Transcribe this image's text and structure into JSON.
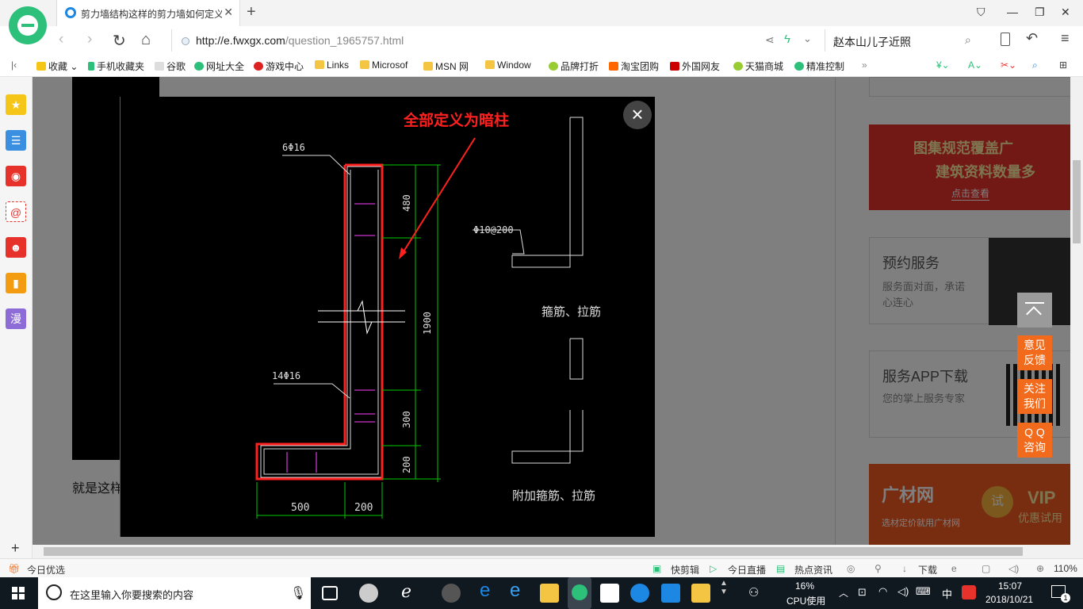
{
  "browser": {
    "tab_title": "剪力墙结构这样的剪力墙如何定义",
    "url_main": "http://e.fwxgx.com",
    "url_path": "/question_1965757.html",
    "search_query": "赵本山儿子近照"
  },
  "bookmarks": [
    "收藏",
    "手机收藏夹",
    "谷歌",
    "网址大全",
    "游戏中心",
    "Links",
    "Microsof",
    "MSN 网",
    "Window",
    "品牌打折",
    "淘宝团购",
    "外国网友",
    "天猫商城",
    "精准控制"
  ],
  "sidebar_icons": [
    "star-icon",
    "news-icon",
    "weibo-icon",
    "mail-icon",
    "game-icon",
    "book-icon",
    "comic-icon"
  ],
  "sidebar_comic": "漫",
  "page": {
    "partial_text": "就是这样",
    "ad1": {
      "line1": "图集规范覆盖广",
      "line2": "建筑资料数量多",
      "btn": "点击查看"
    },
    "ad2": {
      "title": "预约服务",
      "desc": "服务面对面，承诺心连心"
    },
    "ad3": {
      "title": "服务APP下载",
      "desc": "您的掌上服务专家"
    },
    "ad4": {
      "brand": "广材网",
      "slogan": "选材定价就用广材网",
      "badge": "试",
      "vip": "VIP",
      "vip_sub": "优惠试用"
    },
    "float_buttons": [
      "意见\n反馈",
      "关注\n我们",
      "Q Q\n咨询"
    ]
  },
  "drawing": {
    "annotation": "全部定义为暗柱",
    "label_top_rebar": "6Φ16",
    "label_bottom_rebar": "14Φ16",
    "label_stirrup": "Φ10@200",
    "dim_480": "480",
    "dim_1900": "1900",
    "dim_300": "300",
    "dim_200v": "200",
    "dim_500": "500",
    "dim_200h": "200",
    "caption_stirrup": "箍筋、拉筋",
    "caption_additional": "附加箍筋、拉筋"
  },
  "statusbar": {
    "left": "今日优选",
    "items": [
      "快剪辑",
      "今日直播",
      "热点资讯",
      "下载"
    ],
    "zoom": "110%"
  },
  "taskbar": {
    "search_placeholder": "在这里输入你要搜索的内容",
    "cpu_value": "16%",
    "cpu_label": "CPU使用",
    "lang": "中",
    "time": "15:07",
    "date": "2018/10/21",
    "notif_count": "1"
  },
  "colors": {
    "accent_green": "#2cc07a",
    "cad_red": "#ff2020",
    "cad_green": "#00c800",
    "orange": "#f26a1b"
  }
}
